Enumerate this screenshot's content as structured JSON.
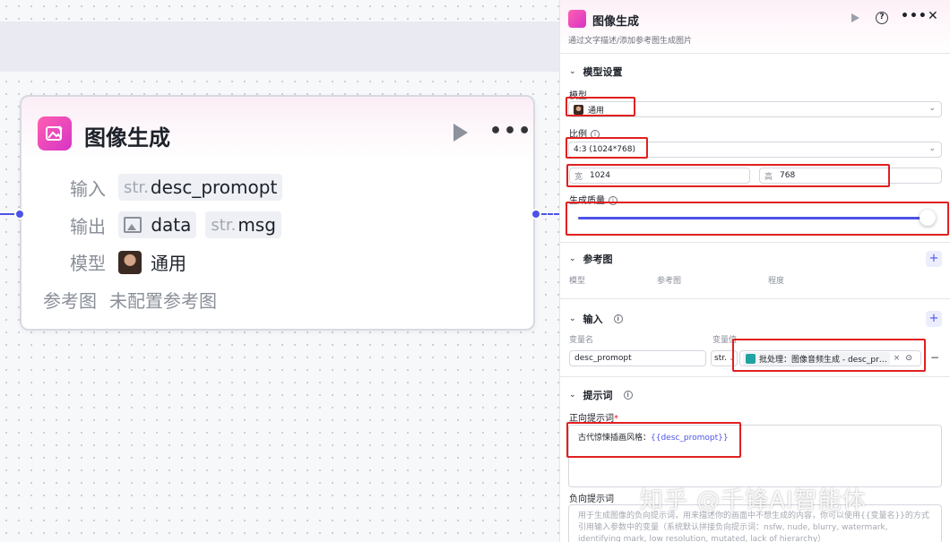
{
  "canvas": {
    "node": {
      "title": "图像生成",
      "input_label": "输入",
      "input_type": "str.",
      "input_value": "desc_promopt",
      "output_label": "输出",
      "output_value1": "data",
      "output_type2": "str.",
      "output_value2": "msg",
      "model_label": "模型",
      "model_value": "通用",
      "ref_label": "参考图",
      "ref_value": "未配置参考图"
    }
  },
  "panel": {
    "title": "图像生成",
    "description": "通过文字描述/添加参考图生成图片",
    "model_settings": {
      "heading": "模型设置",
      "model_label": "模型",
      "model_value": "通用",
      "ratio_label": "比例",
      "ratio_value": "4:3 (1024*768)",
      "width_label": "宽",
      "width_value": "1024",
      "height_label": "高",
      "height_value": "768",
      "quality_label": "生成质量",
      "quality_value": 1.0
    },
    "reference": {
      "heading": "参考图",
      "col_model": "模型",
      "col_ref": "参考图",
      "col_degree": "程度"
    },
    "input": {
      "heading": "输入",
      "col_name": "变量名",
      "col_value": "变量值",
      "var_name": "desc_promopt",
      "var_type": "str.",
      "var_ref": "批处理：图像音频生成 - desc_pr…"
    },
    "prompt": {
      "heading": "提示词",
      "positive_label": "正向提示词",
      "required_mark": "*",
      "positive_text": "古代惊悚插画风格：",
      "positive_var": "{{desc_promopt}}",
      "negative_label": "负向提示词",
      "negative_placeholder": "用于生成图像的负向提示词，用来描述你的画面中不想生成的内容，你可以使用{{变量名}}的方式引用输入参数中的变量（系统默认拼接负向提示词：nsfw, nude, blurry, watermark, identifying mark, low resolution, mutated, lack of hierarchy）"
    }
  },
  "watermark": "知乎 @千锋AI智能体",
  "colors": {
    "accent": "#4d53e8",
    "highlight": "#e02020",
    "node_icon": "#e040b8"
  }
}
